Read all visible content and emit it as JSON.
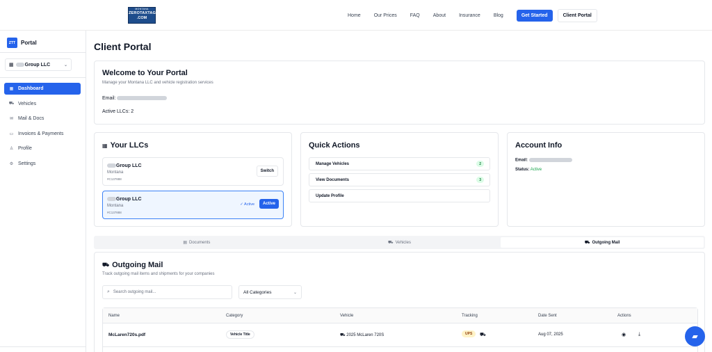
{
  "logo": {
    "line1": "MONTANA",
    "line2": "ZEROTAXTAGS",
    "line3": ".COM"
  },
  "nav": {
    "links": [
      "Home",
      "Our Prices",
      "FAQ",
      "About",
      "Insurance",
      "Blog"
    ],
    "get_started": "Get Started",
    "client_portal": "Client Portal"
  },
  "sidebar": {
    "badge": "ZTT",
    "brand": "Portal",
    "company": "Group LLC",
    "items": [
      {
        "label": "Dashboard",
        "icon": "grid-icon",
        "active": true
      },
      {
        "label": "Vehicles",
        "icon": "car-icon"
      },
      {
        "label": "Mail & Docs",
        "icon": "mail-icon"
      },
      {
        "label": "Invoices & Payments",
        "icon": "credit-card-icon"
      },
      {
        "label": "Profile",
        "icon": "user-icon"
      },
      {
        "label": "Settings",
        "icon": "gear-icon"
      }
    ]
  },
  "page": {
    "title": "Client Portal"
  },
  "welcome": {
    "title": "Welcome to Your Portal",
    "subtitle": "Manage your Montana LLC and vehicle registration services",
    "email_label": "Email:",
    "active_llcs": "Active LLCs: 2"
  },
  "llcs": {
    "title": "Your LLCs",
    "items": [
      {
        "name": "Group LLC",
        "state": "Montana",
        "id": "#C137888",
        "button": "Switch"
      },
      {
        "name": "Group LLC",
        "state": "Montana",
        "id": "#C137888",
        "active_text": "✓ Active",
        "button": "Active"
      }
    ]
  },
  "quick_actions": {
    "title": "Quick Actions",
    "items": [
      {
        "label": "Manage Vehicles",
        "count": "2"
      },
      {
        "label": "View Documents",
        "count": "3"
      },
      {
        "label": "Update Profile",
        "count": ""
      }
    ]
  },
  "account": {
    "title": "Account Info",
    "email_label": "Email:",
    "status_label": "Status:",
    "status_value": "Active"
  },
  "tabs": [
    {
      "label": "Documents",
      "icon": "document-icon"
    },
    {
      "label": "Vehicles",
      "icon": "car-icon"
    },
    {
      "label": "Outgoing Mail",
      "icon": "truck-icon",
      "selected": true
    }
  ],
  "outgoing": {
    "title": "Outgoing Mail",
    "subtitle": "Track outgoing mail items and shipments for your companies",
    "search_placeholder": "Search outgoing mail...",
    "category_value": "All Categories",
    "columns": [
      "Name",
      "Category",
      "Vehicle",
      "Tracking",
      "Date Sent",
      "Actions"
    ],
    "rows": [
      {
        "name": "McLaren720s.pdf",
        "category": "Vehicle Title",
        "vehicle": "2025 McLaren 720S",
        "tracking": "UPS",
        "date": "Aug 07, 2025"
      }
    ]
  },
  "colors": {
    "accent": "#2563eb",
    "success": "#16a34a"
  }
}
